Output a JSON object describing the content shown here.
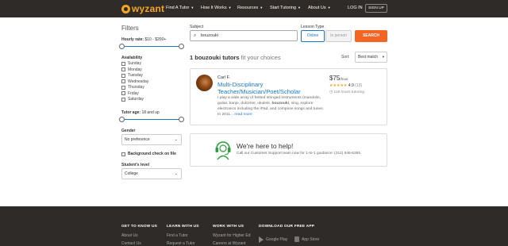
{
  "nav": {
    "logo_text": "wyzant",
    "items": [
      {
        "label": "Find A Tutor",
        "has_caret": true
      },
      {
        "label": "How It Works",
        "has_caret": true
      },
      {
        "label": "Resources",
        "has_caret": true
      },
      {
        "label": "Start Tutoring",
        "has_caret": true
      },
      {
        "label": "About Us",
        "has_caret": true
      }
    ],
    "login": "LOG IN",
    "signup": "SIGN UP"
  },
  "sidebar": {
    "title": "Filters",
    "hourly_rate_label": "Hourly rate:",
    "hourly_rate_value": "$10 - $200+",
    "availability_label": "Availability",
    "days": [
      "Sunday",
      "Monday",
      "Tuesday",
      "Wednesday",
      "Thursday",
      "Friday",
      "Saturday"
    ],
    "tutor_age_label": "Tutor age:",
    "tutor_age_value": "18 and up",
    "gender_label": "Gender",
    "gender_value": "No preference",
    "background_check": "Background check on file",
    "student_level_label": "Student's level",
    "student_level_value": "College"
  },
  "search": {
    "subject_label": "Subject",
    "subject_value": "bouzouki",
    "lesson_type_label": "Lesson Type",
    "online": "Online",
    "in_person": "In person",
    "button": "SEARCH"
  },
  "results": {
    "count_text": "1 bouzouki tutors",
    "fit_text": "fit your choices",
    "sort_label": "Sort:",
    "sort_value": "Best match"
  },
  "tutor": {
    "name": "Carl F.",
    "title": "Multi-Disciplinary Teacher/Musician/Poet/Scholar",
    "desc_before": "I play a wide array of fretted stringed instruments (mandolin, guitar, banjo, dulcimer, ukulele,",
    "desc_bold": "bouzouki",
    "desc_after": ", sing, explore electronics including the iPad, and compose songs and tunes. In 2011...",
    "read_more": "read more",
    "price": "$75",
    "per_hour": "/hour",
    "stars": "★★★★★",
    "rating": "4.9",
    "reviews": "(13)",
    "hours": "119 hours tutoring"
  },
  "help": {
    "title": "We're here to help!",
    "subtitle": "Call our Customer Support team now for 1-to-1 guidance: (312) 646-6365"
  },
  "footer": {
    "col1_head": "GET TO KNOW US",
    "col1_links": [
      "About Us",
      "Contact Us"
    ],
    "col2_head": "LEARN WITH US",
    "col2_links": [
      "Find a Tutor",
      "Request a Tutor"
    ],
    "col3_head": "WORK WITH US",
    "col3_links": [
      "Wyzant for Higher Ed",
      "Careers at Wyzant"
    ],
    "col4_head": "DOWNLOAD OUR FREE APP",
    "google_play": "Google Play",
    "app_store": "App Store"
  },
  "colors": {
    "brand": "#f5a623",
    "accent": "#1a78c2",
    "cta": "#f26522",
    "dark": "#2e2b28",
    "help_green": "#2e9e3e"
  },
  "sliders": {
    "hourly_rate_range_fraction": [
      0,
      1
    ],
    "tutor_age_range_fraction": [
      0,
      1
    ]
  }
}
